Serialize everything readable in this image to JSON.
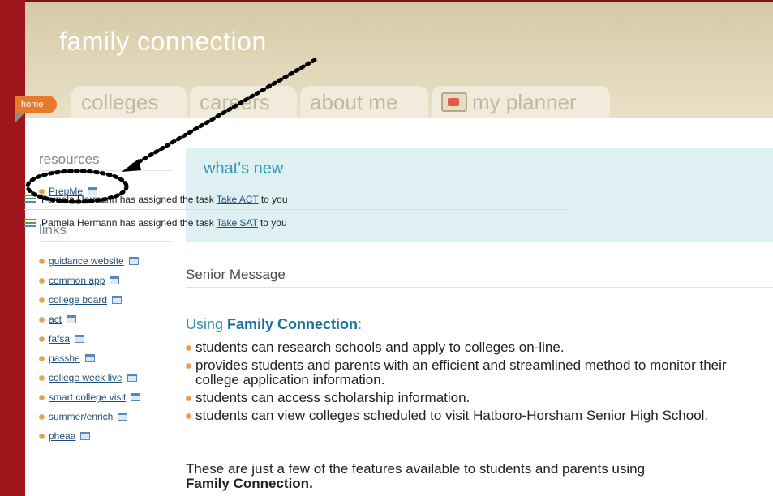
{
  "app": {
    "title": "family connection"
  },
  "nav": {
    "home": "home",
    "tabs": [
      {
        "label": "colleges"
      },
      {
        "label": "careers"
      },
      {
        "label": "about me"
      },
      {
        "label": "my planner",
        "icon": "planner-icon"
      }
    ]
  },
  "sidebar": {
    "resources_heading": "resources",
    "resources": [
      {
        "label": "PrepMe",
        "icon": "new-window-icon"
      }
    ],
    "links_heading": "links",
    "links": [
      {
        "label": "guidance website"
      },
      {
        "label": "common app"
      },
      {
        "label": "college board"
      },
      {
        "label": "act"
      },
      {
        "label": "fafsa"
      },
      {
        "label": "passhe"
      },
      {
        "label": "college week live"
      },
      {
        "label": "smart college visit"
      },
      {
        "label": "summer/enrich"
      },
      {
        "label": "pheaa"
      }
    ]
  },
  "whats_new": {
    "title": "what's new",
    "items": [
      {
        "text": "Pamela Hermann has assigned the task",
        "link": "Take ACT",
        "suffix": "to you"
      },
      {
        "text": "Pamela Hermann has assigned the task",
        "link": "Take SAT",
        "suffix": "to you"
      }
    ]
  },
  "senior_message": {
    "heading": "Senior Message"
  },
  "using": {
    "prefix": "Using ",
    "bold": "Family Connection",
    "suffix": ":",
    "features": [
      "students can research schools and apply to colleges on-line.",
      "provides students and parents with an efficient and streamlined method to monitor their college application information.",
      "students can access scholarship information.",
      "students can view colleges scheduled to visit Hatboro-Horsham Senior High School."
    ],
    "closing": "These are just a few of the features available to students and parents using",
    "closing_bold": "Family Connection."
  },
  "colors": {
    "brand_red": "#a0141c",
    "home_tab": "#e87a2b",
    "accent_teal": "#2c9ab0",
    "link": "#1f4e79",
    "annotation": "#000000"
  }
}
